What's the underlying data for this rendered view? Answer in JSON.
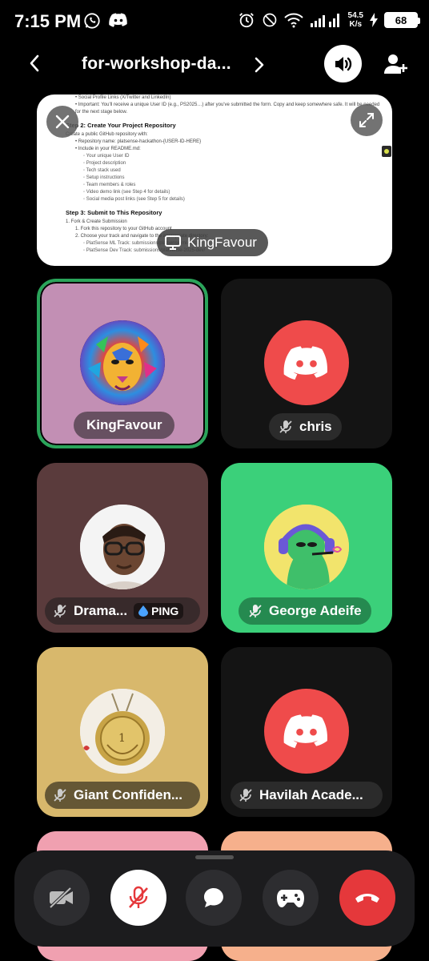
{
  "status_bar": {
    "time": "7:15 PM",
    "net_speed_value": "54.5",
    "net_speed_unit": "K/s",
    "battery": "68",
    "icons": [
      "whatsapp-icon",
      "discord-icon",
      "alarm-icon",
      "dnd-icon",
      "wifi-icon",
      "signal-icon",
      "charging-icon"
    ]
  },
  "header": {
    "channel_title": "for-workshop-da...",
    "icons": [
      "back-arrow-icon",
      "chevron-right-icon",
      "speaker-icon",
      "add-user-icon"
    ]
  },
  "screen_share": {
    "presenter": "KingFavour",
    "doc_lines": [
      {
        "cls": "li",
        "text": "• Social Profile Links (X/Twitter and LinkedIn)"
      },
      {
        "cls": "li",
        "text": "• Important: You'll receive a unique User ID (e.g., PS2025…) after you've submitted the form. Copy and keep somewhere safe. It will be needed for the next stage below."
      },
      {
        "cls": "h",
        "text": "Step 2: Create Your Project Repository"
      },
      {
        "cls": "p",
        "text": "Create a public GitHub repository with:"
      },
      {
        "cls": "li",
        "text": "• Repository name: platsense-hackathon-{USER-ID-HERE}"
      },
      {
        "cls": "li",
        "text": "• Include in your README.md:"
      },
      {
        "cls": "li2",
        "text": "◦ Your unique User ID"
      },
      {
        "cls": "li2",
        "text": "◦ Project description"
      },
      {
        "cls": "li2",
        "text": "◦ Tech stack used"
      },
      {
        "cls": "li2",
        "text": "◦ Setup instructions"
      },
      {
        "cls": "li2",
        "text": "◦ Team members & roles"
      },
      {
        "cls": "li2",
        "text": "◦ Video demo link (see Step 4 for details)"
      },
      {
        "cls": "li2",
        "text": "◦ Social media post links (see Step 5 for details)"
      },
      {
        "cls": "h",
        "text": "Step 3: Submit to This Repository"
      },
      {
        "cls": "p",
        "text": "1. Fork & Create Submission"
      },
      {
        "cls": "li",
        "text": "1. Fork this repository to your GitHub account"
      },
      {
        "cls": "li",
        "text": "2. Choose your track and navigate to the appropriate directory:"
      },
      {
        "cls": "li2",
        "text": "◦ PlatSense ML Track: submissions/platsense-ml-track/"
      },
      {
        "cls": "li2",
        "text": "◦ PlatSense Dev Track: submissions/platsense-2025-dev/"
      }
    ]
  },
  "participants": [
    {
      "name": "KingFavour",
      "bg": "#c28fb4",
      "speaking": true,
      "muted": false,
      "avatar": "lion-avatar"
    },
    {
      "name": "chris",
      "bg": "#141414",
      "muted": true,
      "avatar": "discord-avatar-red"
    },
    {
      "name": "Drama...",
      "bg": "#5a3b3c",
      "muted": false,
      "deafened_mic": true,
      "badge": "PING",
      "avatar": "photo-avatar"
    },
    {
      "name": "George Adeife",
      "bg": "#3bd07a",
      "muted": true,
      "avatar": "green-character-avatar"
    },
    {
      "name": "Giant Confiden...",
      "bg": "#d8b86c",
      "muted": true,
      "avatar": "medal-avatar"
    },
    {
      "name": "Havilah Acade...",
      "bg": "#141414",
      "muted": true,
      "avatar": "discord-avatar-red"
    }
  ],
  "controls": {
    "buttons": [
      "camera-off",
      "mic-muted",
      "chat",
      "activities",
      "hang-up"
    ],
    "colors": {
      "hangup": "#e5383b",
      "mic_muted": "#ffffff",
      "default": "#2d2d30",
      "accent_red": "#ef4b4b"
    }
  }
}
